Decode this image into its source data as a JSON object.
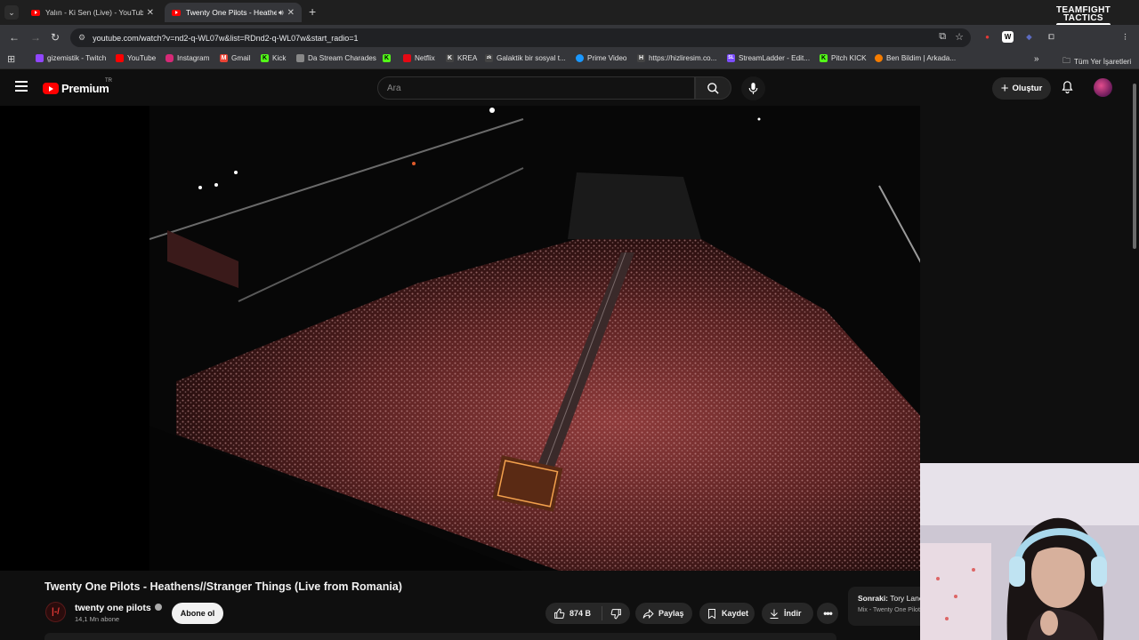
{
  "browser": {
    "tabs": [
      {
        "title": "Yalın - Ki Sen (Live) - YouTube",
        "active": false
      },
      {
        "title": "Twenty One Pilots - Heathens",
        "active": true
      }
    ],
    "url": "youtube.com/watch?v=nd2-q-WL07w&list=RDnd2-q-WL07w&start_radio=1",
    "overlay_logo": {
      "line1": "TEAMFIGHT",
      "line2": "TACTICS"
    },
    "bookmarks": [
      {
        "label": "gizemistik - Twitch",
        "color": "#9146ff",
        "glyph": ""
      },
      {
        "label": "YouTube",
        "color": "#ff0000",
        "glyph": ""
      },
      {
        "label": "Instagram",
        "color": "#d62976",
        "glyph": ""
      },
      {
        "label": "Gmail",
        "color": "#ea4335",
        "glyph": "M"
      },
      {
        "label": "Kick",
        "color": "#53fc18",
        "glyph": "K"
      },
      {
        "label": "Da Stream Charades",
        "color": "#888888",
        "glyph": ""
      },
      {
        "label": "",
        "color": "#53fc18",
        "glyph": "K"
      },
      {
        "label": "Netflix",
        "color": "#e50914",
        "glyph": ""
      },
      {
        "label": "KREA",
        "color": "#444444",
        "glyph": "K"
      },
      {
        "label": "Galaktik bir sosyal t...",
        "color": "#444444",
        "glyph": "zk"
      },
      {
        "label": "Prime Video",
        "color": "#1a98ff",
        "glyph": ""
      },
      {
        "label": "https://hizliresim.co...",
        "color": "#444444",
        "glyph": "H"
      },
      {
        "label": "StreamLadder - Edit...",
        "color": "#7c4dff",
        "glyph": "SL"
      },
      {
        "label": "Pitch KICK",
        "color": "#53fc18",
        "glyph": "K"
      },
      {
        "label": "Ben Bildim | Arkada...",
        "color": "#f57c00",
        "glyph": ""
      }
    ],
    "all_bookmarks": "Tüm Yer İşaretleri"
  },
  "youtube": {
    "logo_text": "Premium",
    "country_code": "TR",
    "search_placeholder": "Ara",
    "create_label": "Oluştur"
  },
  "video": {
    "title": "Twenty One Pilots - Heathens//Stranger Things (Live from Romania)",
    "channel_name": "twenty one pilots",
    "channel_initial": "|-/",
    "subscribers": "14,1 Mn abone",
    "subscribe_label": "Abone ol",
    "likes": "874 B",
    "share_label": "Paylaş",
    "save_label": "Kaydet",
    "download_label": "İndir",
    "up_next_prefix": "Sonraki:",
    "up_next_title": "Tory Lanez",
    "up_next_sub": "Mix - Twenty One Pilots"
  }
}
